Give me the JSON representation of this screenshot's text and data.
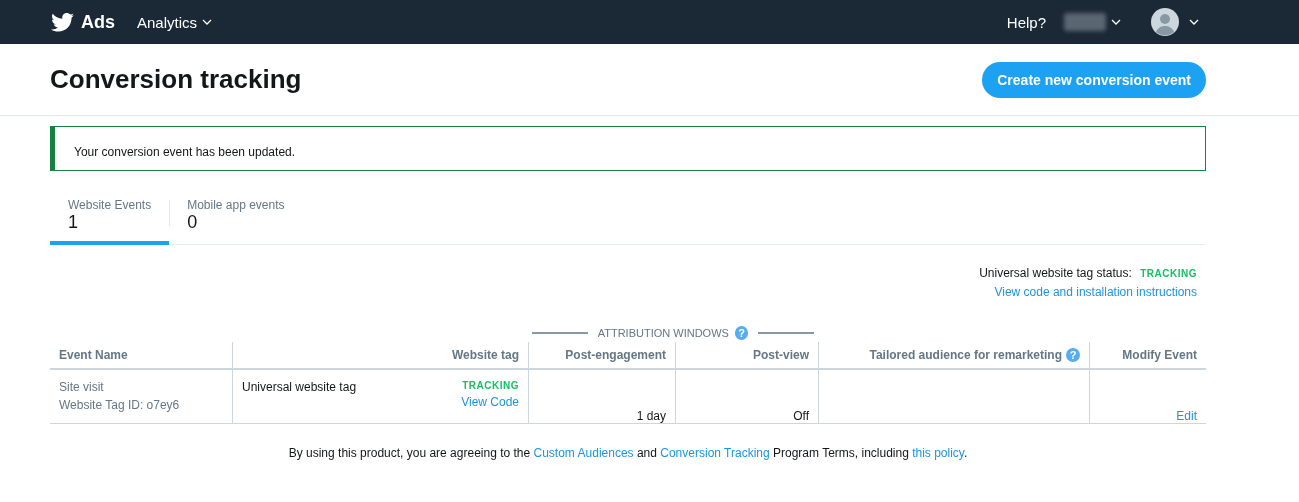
{
  "nav": {
    "brand": "Ads",
    "menu": "Analytics",
    "help": "Help?"
  },
  "header": {
    "title": "Conversion tracking",
    "button": "Create new conversion event"
  },
  "alert": {
    "message": "Your conversion event has been updated."
  },
  "tabs": [
    {
      "label": "Website Events",
      "count": "1",
      "selected": true
    },
    {
      "label": "Mobile app events",
      "count": "0",
      "selected": false
    }
  ],
  "tag_status": {
    "label": "Universal website tag status:",
    "status": "TRACKING",
    "link": "View code and installation instructions"
  },
  "table": {
    "group_header": {
      "label": "ATTRIBUTION WINDOWS",
      "help": "?"
    },
    "columns": [
      {
        "label": "Event Name"
      },
      {
        "label": "Website tag"
      },
      {
        "label": "Post-engagement"
      },
      {
        "label": "Post-view"
      },
      {
        "label": "Tailored audience for remarketing",
        "help": "?"
      },
      {
        "label": "Modify Event"
      }
    ],
    "rows": [
      {
        "event_name": "Site visit",
        "tag_id": "Website Tag ID: o7ey6",
        "website_tag": "Universal website tag",
        "tag_status": "TRACKING",
        "tag_link": "View Code",
        "post_engagement": "1 day",
        "post_view": "Off",
        "modify": "Edit"
      }
    ]
  },
  "footer": {
    "parts": [
      {
        "kind": "text",
        "text": "By using this product, you are agreeing to the "
      },
      {
        "kind": "link",
        "text": "Custom Audiences"
      },
      {
        "kind": "text",
        "text": " and "
      },
      {
        "kind": "link",
        "text": "Conversion Tracking"
      },
      {
        "kind": "text",
        "text": " Program Terms, including "
      },
      {
        "kind": "link",
        "text": "this policy"
      },
      {
        "kind": "text",
        "text": "."
      }
    ]
  }
}
